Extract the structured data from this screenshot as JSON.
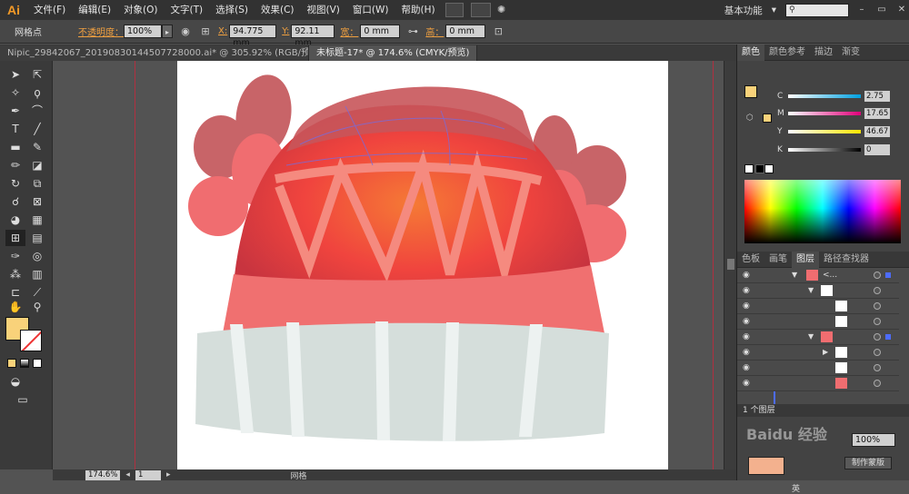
{
  "app": {
    "logo": "Ai"
  },
  "menu": [
    "文件(F)",
    "编辑(E)",
    "对象(O)",
    "文字(T)",
    "选择(S)",
    "效果(C)",
    "视图(V)",
    "窗口(W)",
    "帮助(H)"
  ],
  "workspace": {
    "label": "基本功能",
    "dropdown": "▾"
  },
  "window_buttons": [
    "–",
    "▭",
    "✕"
  ],
  "control_bar": {
    "selection_label": "网格点",
    "opacity_label": "不透明度：",
    "opacity_value": "100%",
    "x_label": "X:",
    "x_value": "94.775 mm",
    "y_label": "Y:",
    "y_value": "92.11 mm",
    "w_label": "宽：",
    "w_value": "0 mm",
    "h_label": "高：",
    "h_value": "0 mm"
  },
  "doc_tabs": [
    {
      "label": "Nipic_29842067_20190830144507728000.ai* @ 305.92% (RGB/预览)",
      "active": false
    },
    {
      "label": "未标题-17* @ 174.6% (CMYK/预览)",
      "active": true
    }
  ],
  "color_panel": {
    "tabs": [
      "颜色",
      "颜色参考",
      "描边",
      "渐变"
    ],
    "channels": [
      {
        "name": "C",
        "value": "2.75",
        "colors": [
          "#ffffff",
          "#00a0e0"
        ]
      },
      {
        "name": "M",
        "value": "17.65",
        "colors": [
          "#ffffff",
          "#e0007a"
        ]
      },
      {
        "name": "Y",
        "value": "46.67",
        "colors": [
          "#ffffff",
          "#ffe600"
        ]
      },
      {
        "name": "K",
        "value": "0",
        "colors": [
          "#ffffff",
          "#000000"
        ]
      }
    ],
    "fill_color": "#f9d27a"
  },
  "layers_panel": {
    "tabs": [
      "色板",
      "画笔",
      "图层",
      "路径查找器"
    ],
    "top_layer_name": "<...",
    "footer_label": "1 个图层"
  },
  "lower_panel": {
    "percent": "100%",
    "button": "制作蒙版"
  },
  "status_bar": {
    "zoom": "174.6%",
    "page": "1",
    "mode": "网格"
  },
  "watermark": {
    "text": "Baidu 经验"
  },
  "ime": {
    "label": "英"
  },
  "colors": {
    "hat_top": "#f0525a",
    "hat_band": "#f08070",
    "cuff": "#d5dedb",
    "cuff_stripe": "#edf2f1",
    "ear": "#c86468",
    "guide": "#b03040"
  }
}
